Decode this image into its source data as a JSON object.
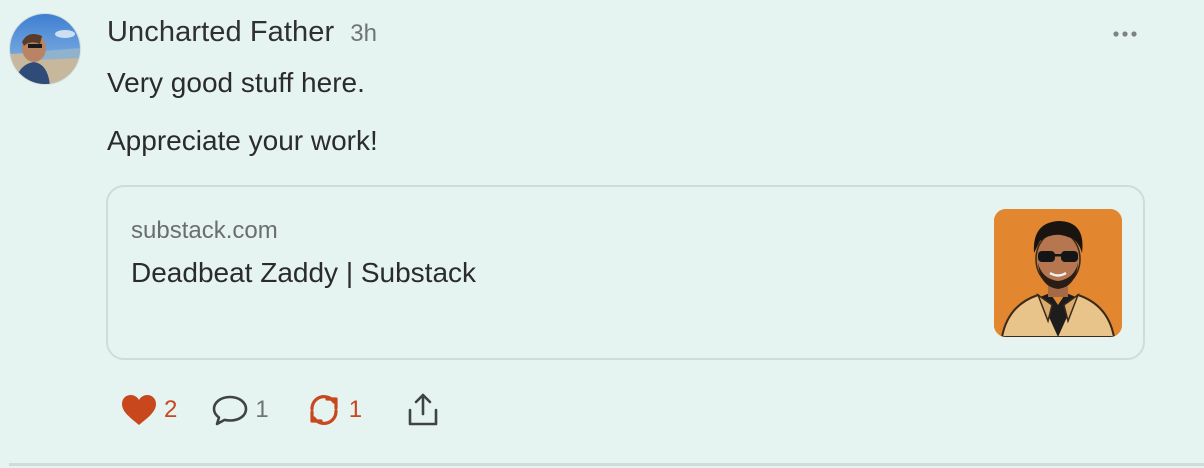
{
  "note": {
    "author": "Uncharted Father",
    "time": "3h",
    "paragraphs": [
      "Very good stuff here.",
      "Appreciate your work!"
    ],
    "more_icon": "ellipsis-icon"
  },
  "link_card": {
    "domain": "substack.com",
    "title": "Deadbeat Zaddy | Substack",
    "thumbnail_bg": "#e2862f"
  },
  "actions": {
    "likes": "2",
    "comments": "1",
    "restacks": "1",
    "like_icon": "heart-icon",
    "comment_icon": "comment-icon",
    "restack_icon": "restack-icon",
    "share_icon": "share-icon"
  },
  "colors": {
    "background": "#e5f4f1",
    "accent": "#c9471d",
    "card_border": "#cfdcd9"
  }
}
